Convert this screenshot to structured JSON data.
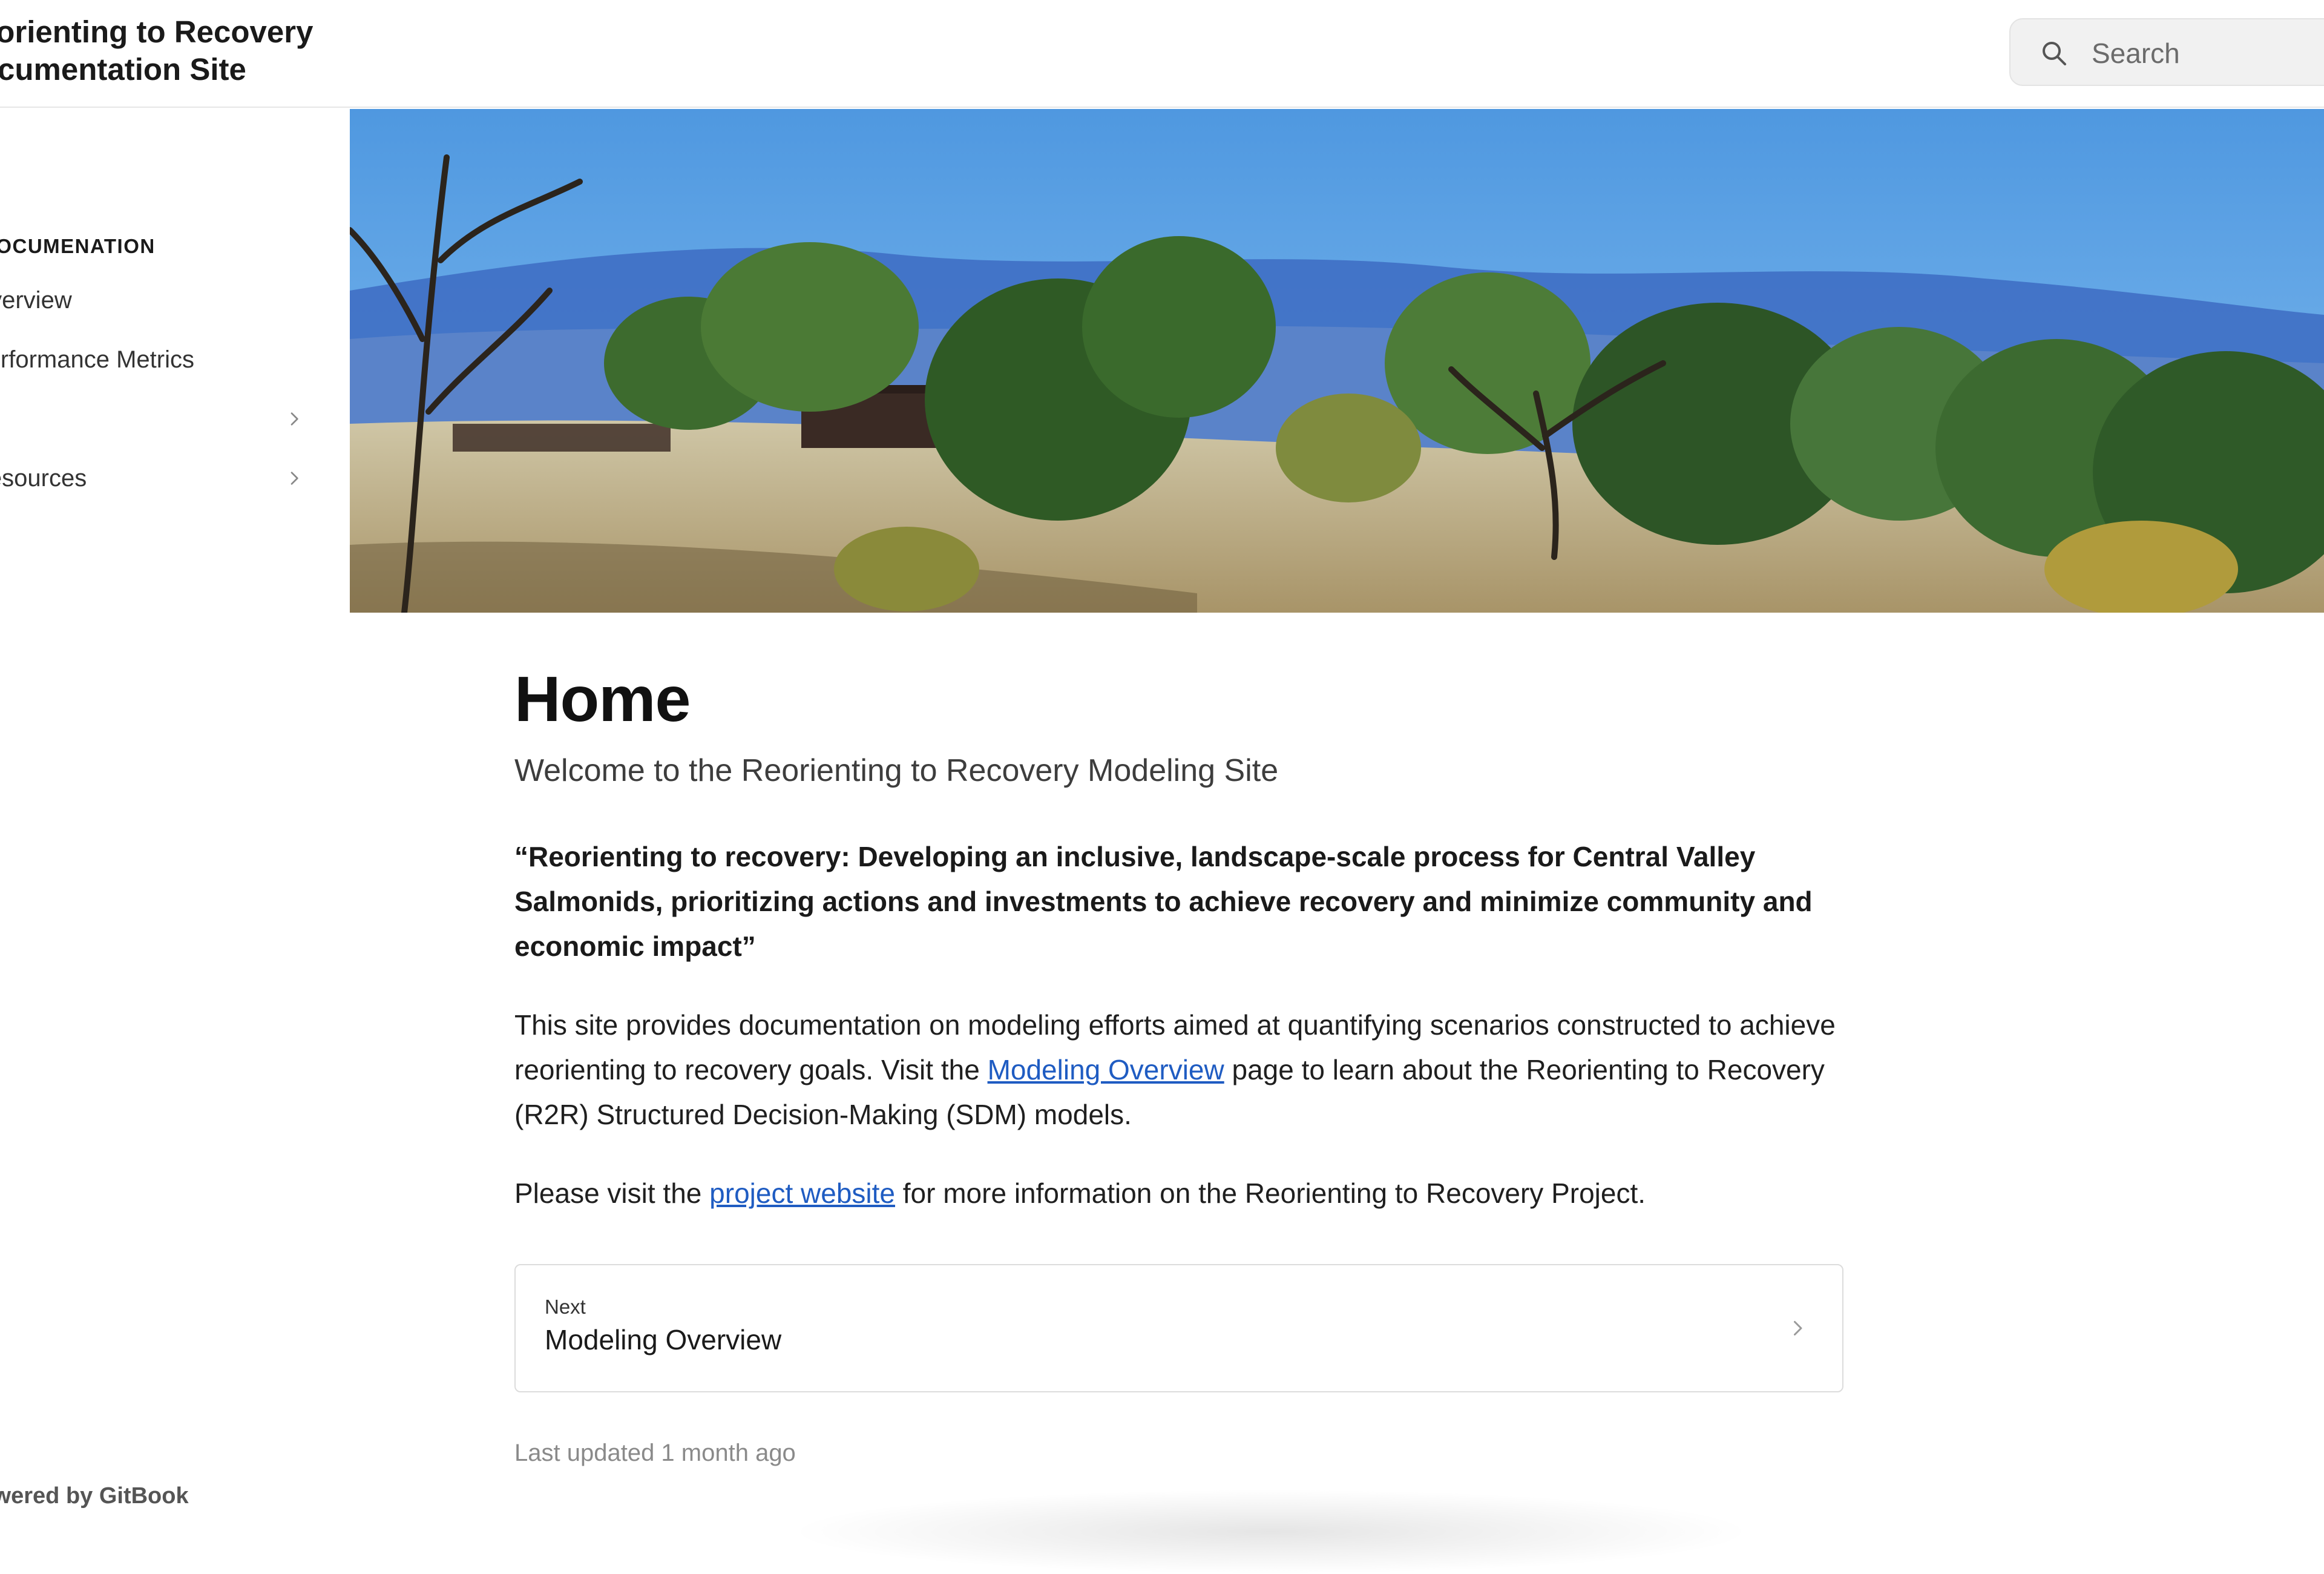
{
  "header": {
    "site_title_line1": "Reorienting to Recovery",
    "site_title_line2": "Documentation Site",
    "search_placeholder": "Search"
  },
  "sidebar": {
    "section_title": "DOCUMENATION",
    "items": [
      {
        "label": "Overview",
        "has_chevron": false
      },
      {
        "label": "Performance Metrics",
        "has_chevron": false
      },
      {
        "label": "",
        "has_chevron": true
      },
      {
        "label": "Resources",
        "has_chevron": true
      }
    ],
    "powered_by": "Powered by GitBook"
  },
  "hero": {
    "image_description": "landscape with oak trees, dry grass field, old wooden shed, blue mountains and sky"
  },
  "main": {
    "title": "Home",
    "subtitle": "Welcome to the Reorienting to Recovery Modeling Site",
    "quote": "“Reorienting to recovery: Developing an inclusive, landscape-scale process for Central Valley Salmonids, prioritizing actions and investments to achieve recovery and minimize community and economic impact”",
    "para1_before": "This site provides documentation on modeling efforts aimed at quantifying scenarios constructed to achieve reorienting to recovery goals. Visit the ",
    "para1_link": "Modeling Overview",
    "para1_after": " page to learn about the Reorienting to Recovery (R2R) Structured Decision-Making (SDM) models.",
    "para2_before": "Please visit the ",
    "para2_link": "project website",
    "para2_after": " for more information on the Reorienting to Recovery Project.",
    "next_label": "Next",
    "next_title": "Modeling Overview",
    "last_updated": "Last updated 1 month ago"
  },
  "colors": {
    "link": "#1f5cc2",
    "border": "#dcdcdc",
    "search_bg": "#f1f1f1"
  },
  "icons": {
    "search": "search-icon",
    "chevron": "chevron-right-icon"
  }
}
